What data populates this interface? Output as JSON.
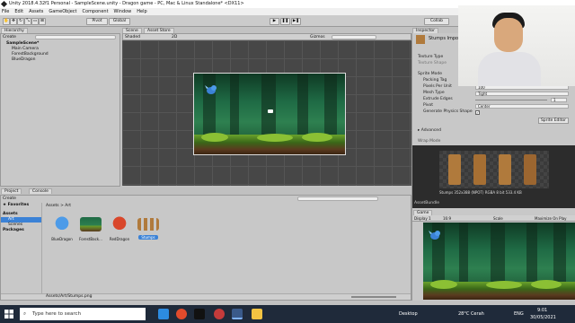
{
  "window": {
    "title": "Unity 2018.4.32f1 Personal - SampleScene.unity - Dragon game - PC, Mac & Linux Standalone* <DX11>"
  },
  "menu": [
    "File",
    "Edit",
    "Assets",
    "GameObject",
    "Component",
    "Window",
    "Help"
  ],
  "toolbar": {
    "pivot": "Pivot",
    "global": "Global",
    "collab": "Collab"
  },
  "hierarchy": {
    "tab": "Hierarchy",
    "create": "Create",
    "scene": "SampleScene*",
    "items": [
      "Main Camera",
      "ForestBackground",
      "BlueDragon"
    ]
  },
  "scene": {
    "tab_scene": "Scene",
    "tab_asset_store": "Asset Store",
    "shaded": "Shaded",
    "mode2d": "2D",
    "gizmos": "Gizmos"
  },
  "project": {
    "tab_project": "Project",
    "tab_console": "Console",
    "create": "Create",
    "favorites": "Favorites",
    "breadcrumb": "Assets > Art",
    "tree": [
      "Assets",
      "Art",
      "Scenes",
      "Packages"
    ],
    "assets": [
      "BlueDragon",
      "ForestBack...",
      "RedDragon",
      "Stumps"
    ],
    "footer_path": "Assets/Art/Stumps.png"
  },
  "inspector": {
    "tab": "Inspector",
    "header": "Stumps Impo",
    "texture_type_label": "Texture Type",
    "texture_shape_label": "Texture Shape",
    "sprite_mode_label": "Sprite Mode",
    "packing_tag_label": "Packing Tag",
    "pixels_per_unit_label": "Pixels Per Unit",
    "pixels_per_unit_value": "100",
    "mesh_type_label": "Mesh Type",
    "mesh_type_value": "Tight",
    "extrude_label": "Extrude Edges",
    "extrude_value": "1",
    "pivot_label": "Pivot",
    "pivot_value": "Center",
    "physics_label": "Generate Physics Shape",
    "sprite_editor": "Sprite Editor",
    "advanced": "Advanced",
    "wrap_mode": "Wrap Mode"
  },
  "preview": {
    "caption": "Stumps  352x388 (NPOT)  RGBA 8 bit  533.4 KB",
    "assetbundle": "AssetBundle"
  },
  "game": {
    "tab": "Game",
    "display": "Display 1",
    "aspect": "16:9",
    "scale": "Scale",
    "maximize": "Maximize On Play"
  },
  "taskbar": {
    "search": "Type here to search",
    "desktop": "Desktop",
    "weather": "28°C  Cerah",
    "lang": "ENG",
    "time": "9:01",
    "date": "30/05/2021"
  },
  "colors": {
    "unity_chrome": "#c8c8c8",
    "scene_bg": "#474747",
    "taskbar": "#1f2a3a",
    "selected": "#3b82d6"
  }
}
